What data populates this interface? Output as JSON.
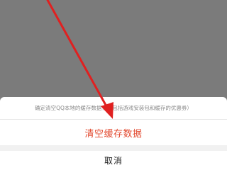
{
  "overlay": {
    "color": "#7b7b7b"
  },
  "sheet": {
    "message": "确定清空QQ本地的缓存数据？（包括游戏安装包和缓存的优惠券）",
    "clear_label": "清空缓存数据",
    "cancel_label": "取消",
    "clear_color": "#e2492f"
  },
  "annotation": {
    "icon": "red-arrow-icon",
    "color": "#e02020"
  }
}
